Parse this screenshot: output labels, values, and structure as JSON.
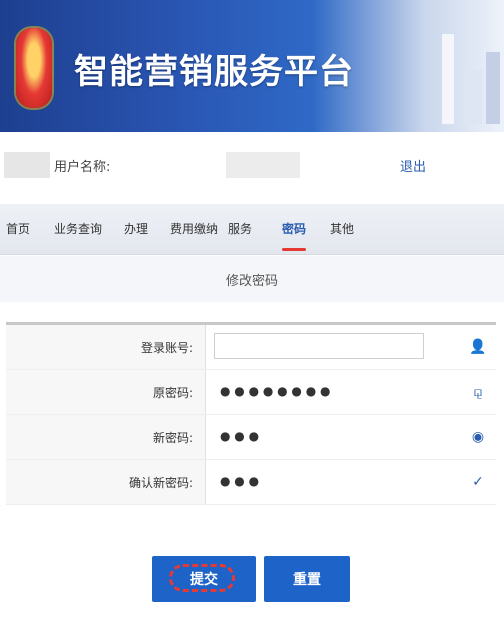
{
  "header": {
    "title": "智能营销服务平台",
    "emblem_icon": "emblem-icon",
    "deco_icon": "building-decoration-icon"
  },
  "user_bar": {
    "label": "用户名称:",
    "logout": "退出"
  },
  "tabs": [
    {
      "label": "首页"
    },
    {
      "label": "业务查询"
    },
    {
      "label": "办理"
    },
    {
      "label": "费用缴纳"
    },
    {
      "label": "服务"
    },
    {
      "label": "密码"
    },
    {
      "label": "其他"
    }
  ],
  "active_tab_index": 5,
  "subbar": {
    "title": "修改密码"
  },
  "form": {
    "rows": [
      {
        "label": "登录账号:",
        "value": "",
        "icon": "user-icon",
        "type": "input"
      },
      {
        "label": "原密码:",
        "value": "● ● ● ● ● ● ● ●",
        "icon": "key-icon",
        "type": "text"
      },
      {
        "label": "新密码:",
        "value": "● ● ●",
        "icon": "lock-icon",
        "type": "text"
      },
      {
        "label": "确认新密码:",
        "value": "● ● ●",
        "icon": "shield-icon",
        "type": "text"
      }
    ]
  },
  "buttons": {
    "submit": "提交",
    "reset": "重置"
  },
  "colors": {
    "brand_blue": "#1e63c7",
    "header_dark": "#1e3f8f",
    "accent_red": "#e53935"
  }
}
